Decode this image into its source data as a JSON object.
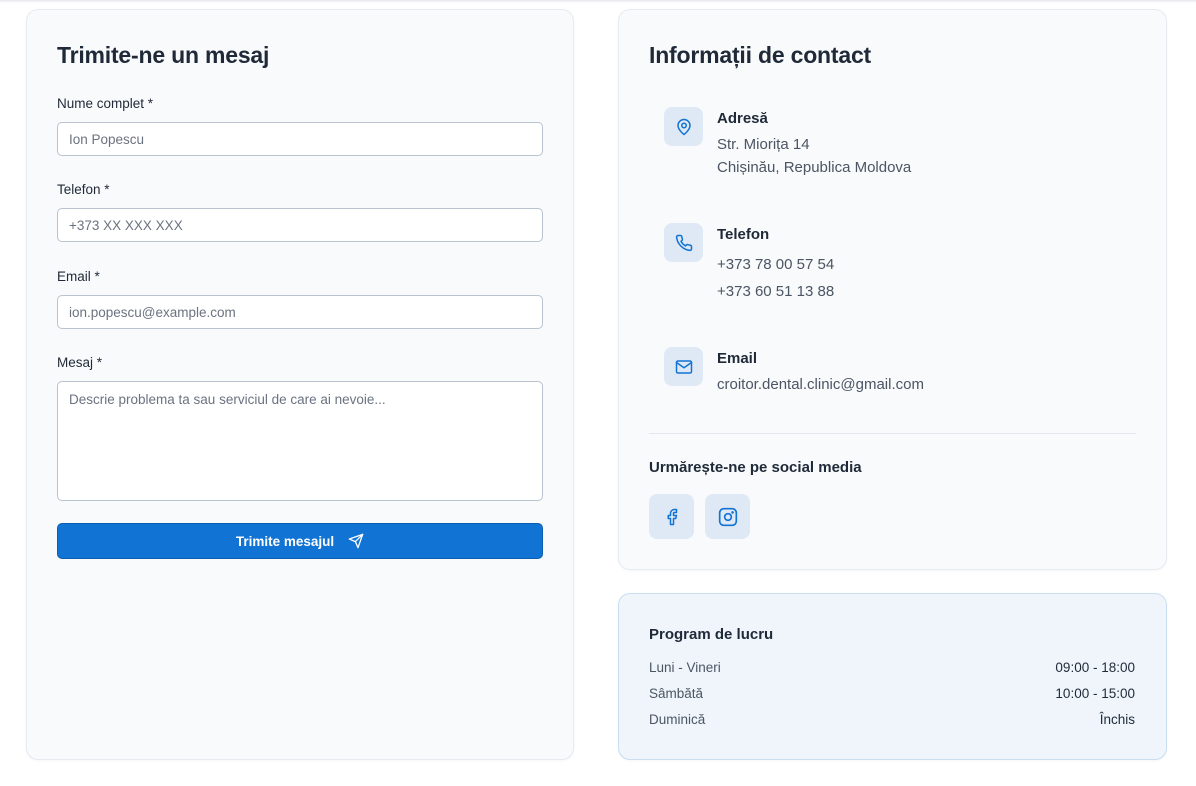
{
  "form": {
    "title": "Trimite-ne un mesaj",
    "fields": [
      {
        "label": "Nume complet *",
        "placeholder": "Ion Popescu"
      },
      {
        "label": "Telefon *",
        "placeholder": "+373 XX XXX XXX"
      },
      {
        "label": "Email *",
        "placeholder": "ion.popescu@example.com"
      },
      {
        "label": "Mesaj *",
        "placeholder": "Descrie problema ta sau serviciul de care ai nevoie..."
      }
    ],
    "submit_label": "Trimite mesajul",
    "submit_icon": "send-icon"
  },
  "contact": {
    "title": "Informații de contact",
    "address": {
      "icon": "map-pin-icon",
      "title": "Adresă",
      "line1": "Str. Miorița 14",
      "line2": "Chișinău, Republica Moldova"
    },
    "phone": {
      "icon": "phone-icon",
      "title": "Telefon",
      "line1": "+373 78 00 57 54",
      "line2": "+373 60 51 13 88"
    },
    "email": {
      "icon": "mail-icon",
      "title": "Email",
      "line1": "croitor.dental.clinic@gmail.com"
    },
    "social": {
      "title": "Urmărește-ne pe social media",
      "items": [
        "facebook-icon",
        "instagram-icon"
      ]
    }
  },
  "hours": {
    "title": "Program de lucru",
    "rows": [
      {
        "day": "Luni - Vineri",
        "time": "09:00 - 18:00"
      },
      {
        "day": "Sâmbătă",
        "time": "10:00 - 15:00"
      },
      {
        "day": "Duminică",
        "time": "Închis"
      }
    ]
  },
  "colors": {
    "accent": "#1173d4",
    "icon_bg": "#dfe9f5",
    "card_bg": "#f8fafc",
    "hours_bg": "#eff5fb"
  }
}
